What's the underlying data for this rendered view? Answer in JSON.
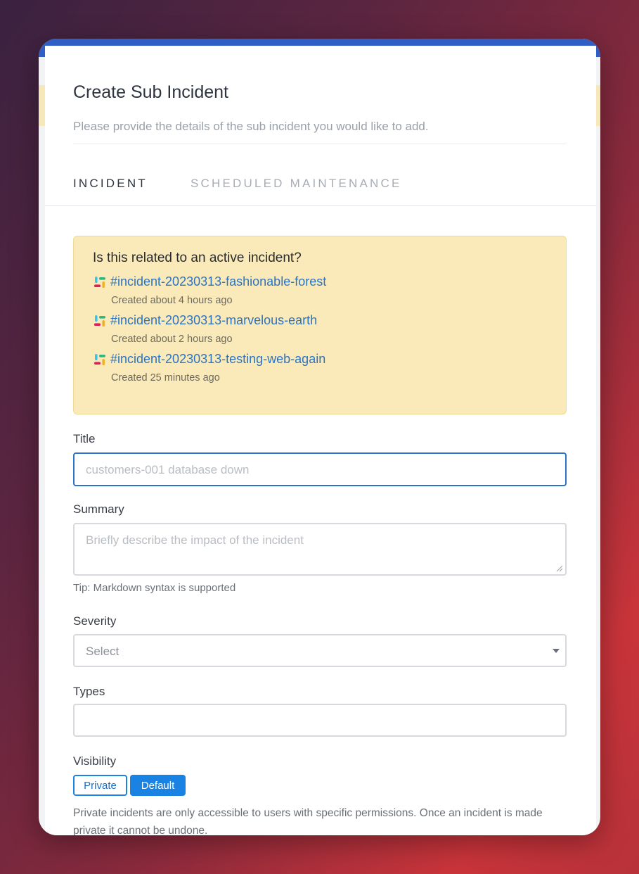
{
  "modal": {
    "title": "Create Sub Incident",
    "subtitle": "Please provide the details of the sub incident you would like to add."
  },
  "tabs": [
    {
      "label": "INCIDENT",
      "active": true
    },
    {
      "label": "SCHEDULED MAINTENANCE",
      "active": false
    }
  ],
  "related": {
    "question": "Is this related to an active incident?",
    "icon": "slack-icon",
    "items": [
      {
        "name": "#incident-20230313-fashionable-forest",
        "created": "Created about 4 hours ago"
      },
      {
        "name": "#incident-20230313-marvelous-earth",
        "created": "Created about 2 hours ago"
      },
      {
        "name": "#incident-20230313-testing-web-again",
        "created": "Created 25 minutes ago"
      }
    ]
  },
  "form": {
    "title_label": "Title",
    "title_placeholder": "customers-001 database down",
    "summary_label": "Summary",
    "summary_placeholder": "Briefly describe the impact of the incident",
    "summary_tip": "Tip: Markdown syntax is supported",
    "severity_label": "Severity",
    "severity_value": "Select",
    "types_label": "Types",
    "visibility_label": "Visibility",
    "visibility_private": "Private",
    "visibility_default": "Default",
    "visibility_note": "Private incidents are only accessible to users with specific permissions. Once an incident is made private it cannot be undone."
  },
  "colors": {
    "accent": "#1a82e2",
    "link": "#2b74c4",
    "alert_bg": "#faeab9",
    "focus_border": "#2a73c9"
  }
}
